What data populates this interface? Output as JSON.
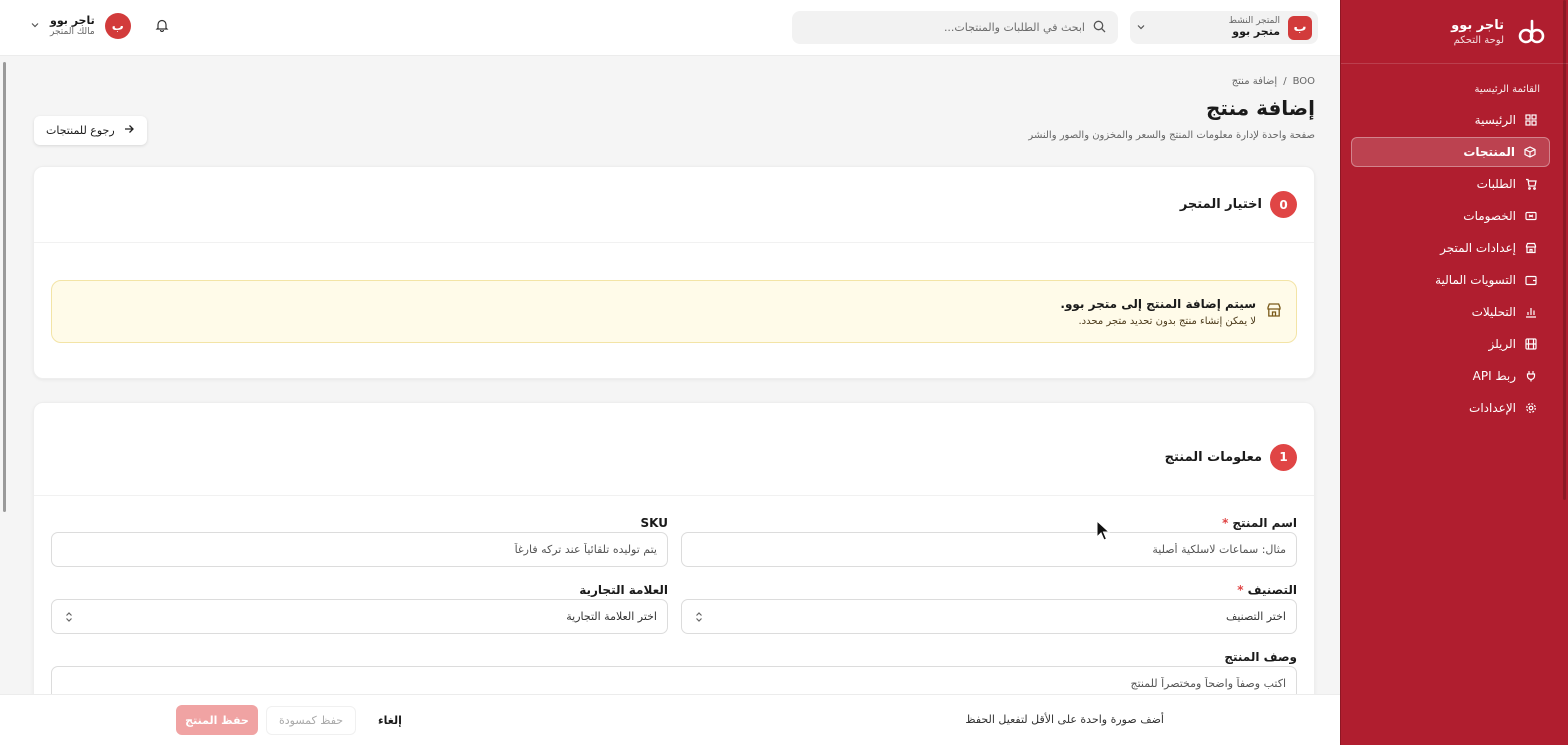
{
  "brand": {
    "name": "تاجر بوو",
    "subtitle": "لوحة التحكم"
  },
  "sidebar": {
    "section_title": "القائمة الرئيسية",
    "items": [
      {
        "label": "الرئيسية",
        "icon": "grid-icon",
        "active": false
      },
      {
        "label": "المنتجات",
        "icon": "box-icon",
        "active": true
      },
      {
        "label": "الطلبات",
        "icon": "cart-icon",
        "active": false
      },
      {
        "label": "الخصومات",
        "icon": "ticket-icon",
        "active": false
      },
      {
        "label": "إعدادات المتجر",
        "icon": "store-icon",
        "active": false
      },
      {
        "label": "التسويات المالية",
        "icon": "wallet-icon",
        "active": false
      },
      {
        "label": "التحليلات",
        "icon": "bar-chart-icon",
        "active": false
      },
      {
        "label": "الريلز",
        "icon": "film-icon",
        "active": false
      },
      {
        "label": "ربط API",
        "icon": "plug-icon",
        "active": false
      },
      {
        "label": "الإعدادات",
        "icon": "gear-icon",
        "active": false
      }
    ]
  },
  "topbar": {
    "store_label": "المتجر النشط",
    "store_value": "متجر بوو",
    "store_badge": "ب",
    "search_placeholder": "ابحث في الطلبات والمنتجات...",
    "user_name": "تاجر بوو",
    "user_role": "مالك المتجر",
    "user_avatar": "ب"
  },
  "page": {
    "breadcrumb_root": "BOO",
    "breadcrumb_sep": "/",
    "breadcrumb_current": "إضافة منتج",
    "title": "إضافة منتج",
    "subtitle": "صفحة واحدة لإدارة معلومات المنتج والسعر والمخزون والصور والنشر",
    "back_label": "رجوع للمنتجات"
  },
  "store_section": {
    "step": "0",
    "title": "اختيار المتجر",
    "alert_title": "سيتم إضافة المنتج إلى متجر بوو.",
    "alert_desc": "لا يمكن إنشاء منتج بدون تحديد متجر محدد."
  },
  "product_section": {
    "step": "1",
    "title": "معلومات المنتج",
    "name_label": "اسم المنتج",
    "required_mark": "*",
    "name_placeholder": "مثال: سماعات لاسلكية أصلية",
    "sku_label": "SKU",
    "sku_placeholder": "يتم توليده تلقائياً عند تركه فارغاً",
    "category_label": "التصنيف",
    "category_value": "اختر التصنيف",
    "brand_label": "العلامة التجارية",
    "brand_value": "اختر العلامة التجارية",
    "description_label": "وصف المنتج",
    "description_placeholder": "اكتب وصفاً واضحاً ومختصراً للمنتج"
  },
  "footer": {
    "message": "أضف صورة واحدة على الأقل لتفعيل الحفظ",
    "cancel_label": "إلغاء",
    "draft_label": "حفظ كمسودة",
    "save_label": "حفظ المنتج"
  },
  "colors": {
    "sidebar": "#b01e2f",
    "accent": "#e04545",
    "alert_bg": "#fffbe9"
  }
}
